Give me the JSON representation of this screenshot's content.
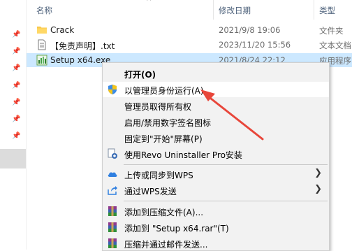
{
  "columns": {
    "name": "名称",
    "modified": "修改日期",
    "type": "类型"
  },
  "files": [
    {
      "name": "Crack",
      "date": "2021/9/8 19:06",
      "type": "文件夹",
      "icon": "folder-icon"
    },
    {
      "name": "【免责声明】.txt",
      "date": "2023/11/20 15:56",
      "type": "文本文档",
      "icon": "text-file-icon"
    },
    {
      "name": "Setup x64.exe",
      "date": "2021/8/24 22:12",
      "type": "应用程序",
      "icon": "installer-icon"
    }
  ],
  "context_menu": {
    "items": [
      {
        "label": "打开(O)",
        "bold": true,
        "icon": ""
      },
      {
        "label": "以管理员身份运行(A)",
        "icon": "uac-shield-icon"
      },
      {
        "label": "管理员取得所有权",
        "icon": ""
      },
      {
        "label": "启用/禁用数字签名图标",
        "icon": ""
      },
      {
        "label": "固定到\"开始\"屏幕(P)",
        "icon": ""
      },
      {
        "label": "使用Revo Uninstaller Pro安装",
        "icon": "revo-icon"
      },
      {
        "label": "上传或同步到WPS",
        "icon": "cloud-icon",
        "submenu": true
      },
      {
        "label": "通过WPS发送",
        "icon": "share-icon",
        "submenu": true
      },
      {
        "label": "添加到压缩文件(A)...",
        "icon": "winrar-icon"
      },
      {
        "label": "添加到 \"Setup x64.rar\"(T)",
        "icon": "winrar-icon"
      },
      {
        "label": "压缩并通过邮件发送...",
        "icon": "winrar-icon"
      }
    ]
  },
  "colors": {
    "selection": "#cce8ff",
    "annotation_arrow": "#e8463a"
  }
}
